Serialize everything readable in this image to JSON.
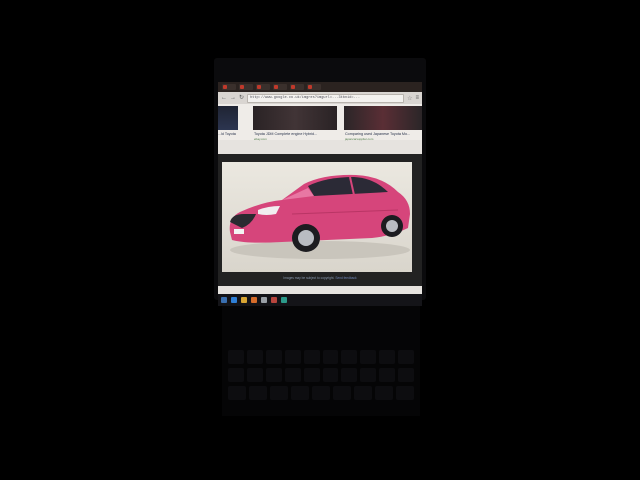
{
  "browser": {
    "tabs": [
      {
        "label": "",
        "favicon": "red-square-icon"
      },
      {
        "label": "",
        "favicon": "red-square-icon"
      },
      {
        "label": "",
        "favicon": "red-square-icon"
      },
      {
        "label": "",
        "favicon": "red-square-icon"
      },
      {
        "label": "",
        "favicon": "red-square-icon"
      },
      {
        "label": "",
        "favicon": "red-square-icon"
      }
    ],
    "url": "http://www.google.co.uk/imgres?imgurl=...3tbnid=..."
  },
  "results": [
    {
      "title": "...ld Toyota",
      "source": ""
    },
    {
      "title": "Toyota JDM Complete engine Hybrid...",
      "source": "ebay.com"
    },
    {
      "title": "Comparing used Japanese Toyota Mo...",
      "source": "japancarsupplier.com"
    }
  ],
  "viewer": {
    "image_alt": "pink Toyota Crown sedan",
    "copyright_text": "Images may be subject to copyright.",
    "copyright_link": "Send feedback"
  },
  "taskbar": {
    "icons": [
      "start-icon",
      "ie-icon",
      "folder-icon",
      "media-icon",
      "chrome-icon",
      "app-icon",
      "app-icon"
    ]
  },
  "colors": {
    "car_body": "#d6457b",
    "browser_bg": "#e6e3df",
    "frame": "#000000"
  }
}
